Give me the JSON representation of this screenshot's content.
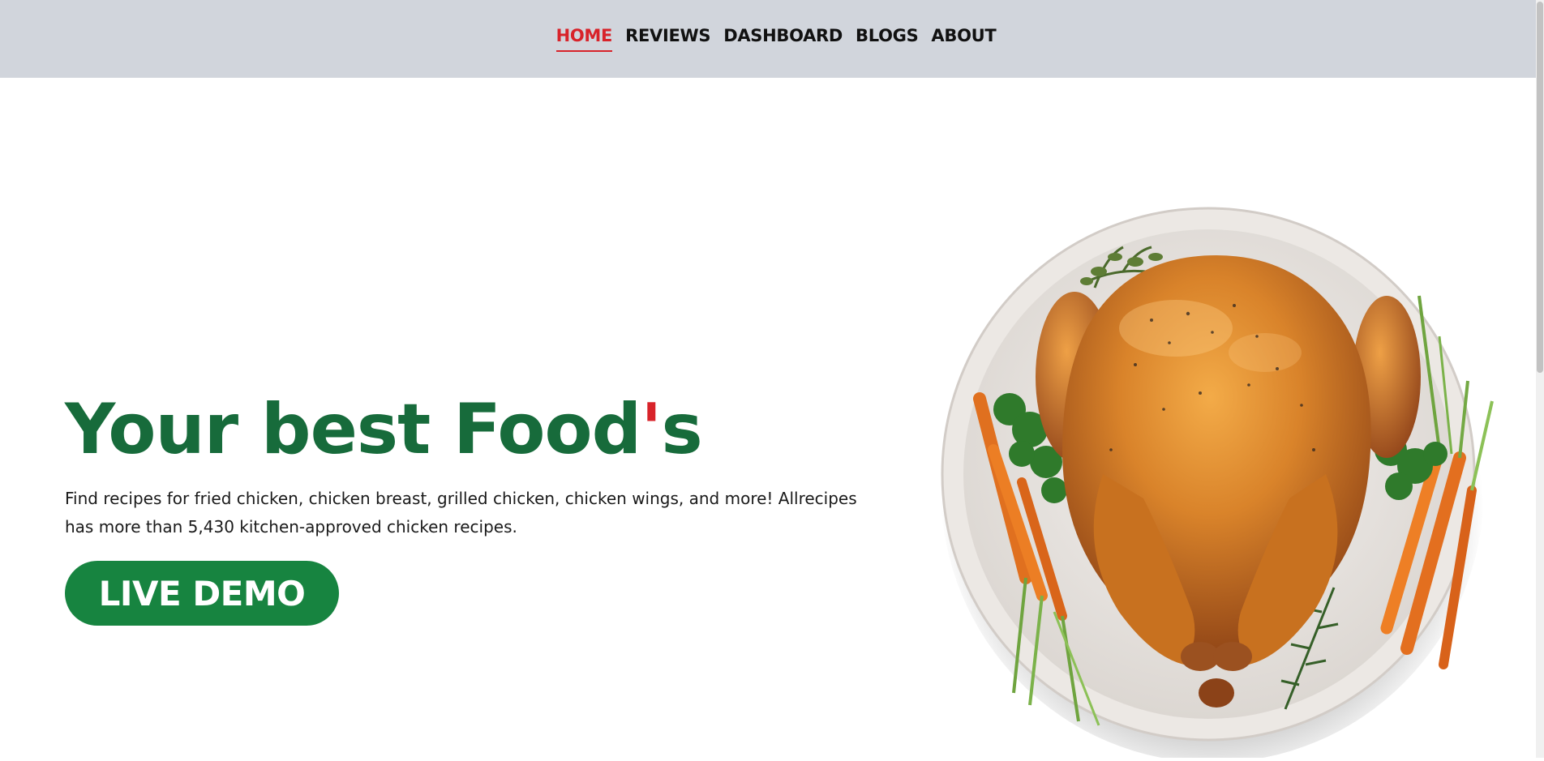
{
  "nav": {
    "items": [
      {
        "label": "HOME",
        "active": true
      },
      {
        "label": "REVIEWS",
        "active": false
      },
      {
        "label": "DASHBOARD",
        "active": false
      },
      {
        "label": "BLOGS",
        "active": false
      },
      {
        "label": "ABOUT",
        "active": false
      }
    ]
  },
  "hero": {
    "title_main": "Your best Food",
    "title_apostrophe": "'",
    "title_end": "s",
    "description": "Find recipes for fried chicken, chicken breast, grilled chicken, chicken wings, and more! Allrecipes has more than 5,430 kitchen-approved chicken recipes.",
    "cta_label": "LIVE DEMO"
  },
  "image": {
    "icon": "roast-chicken-plate-icon"
  },
  "colors": {
    "nav_bg": "#d1d5dc",
    "active": "#d8232a",
    "title_green": "#176b3b",
    "button_green": "#178440"
  }
}
